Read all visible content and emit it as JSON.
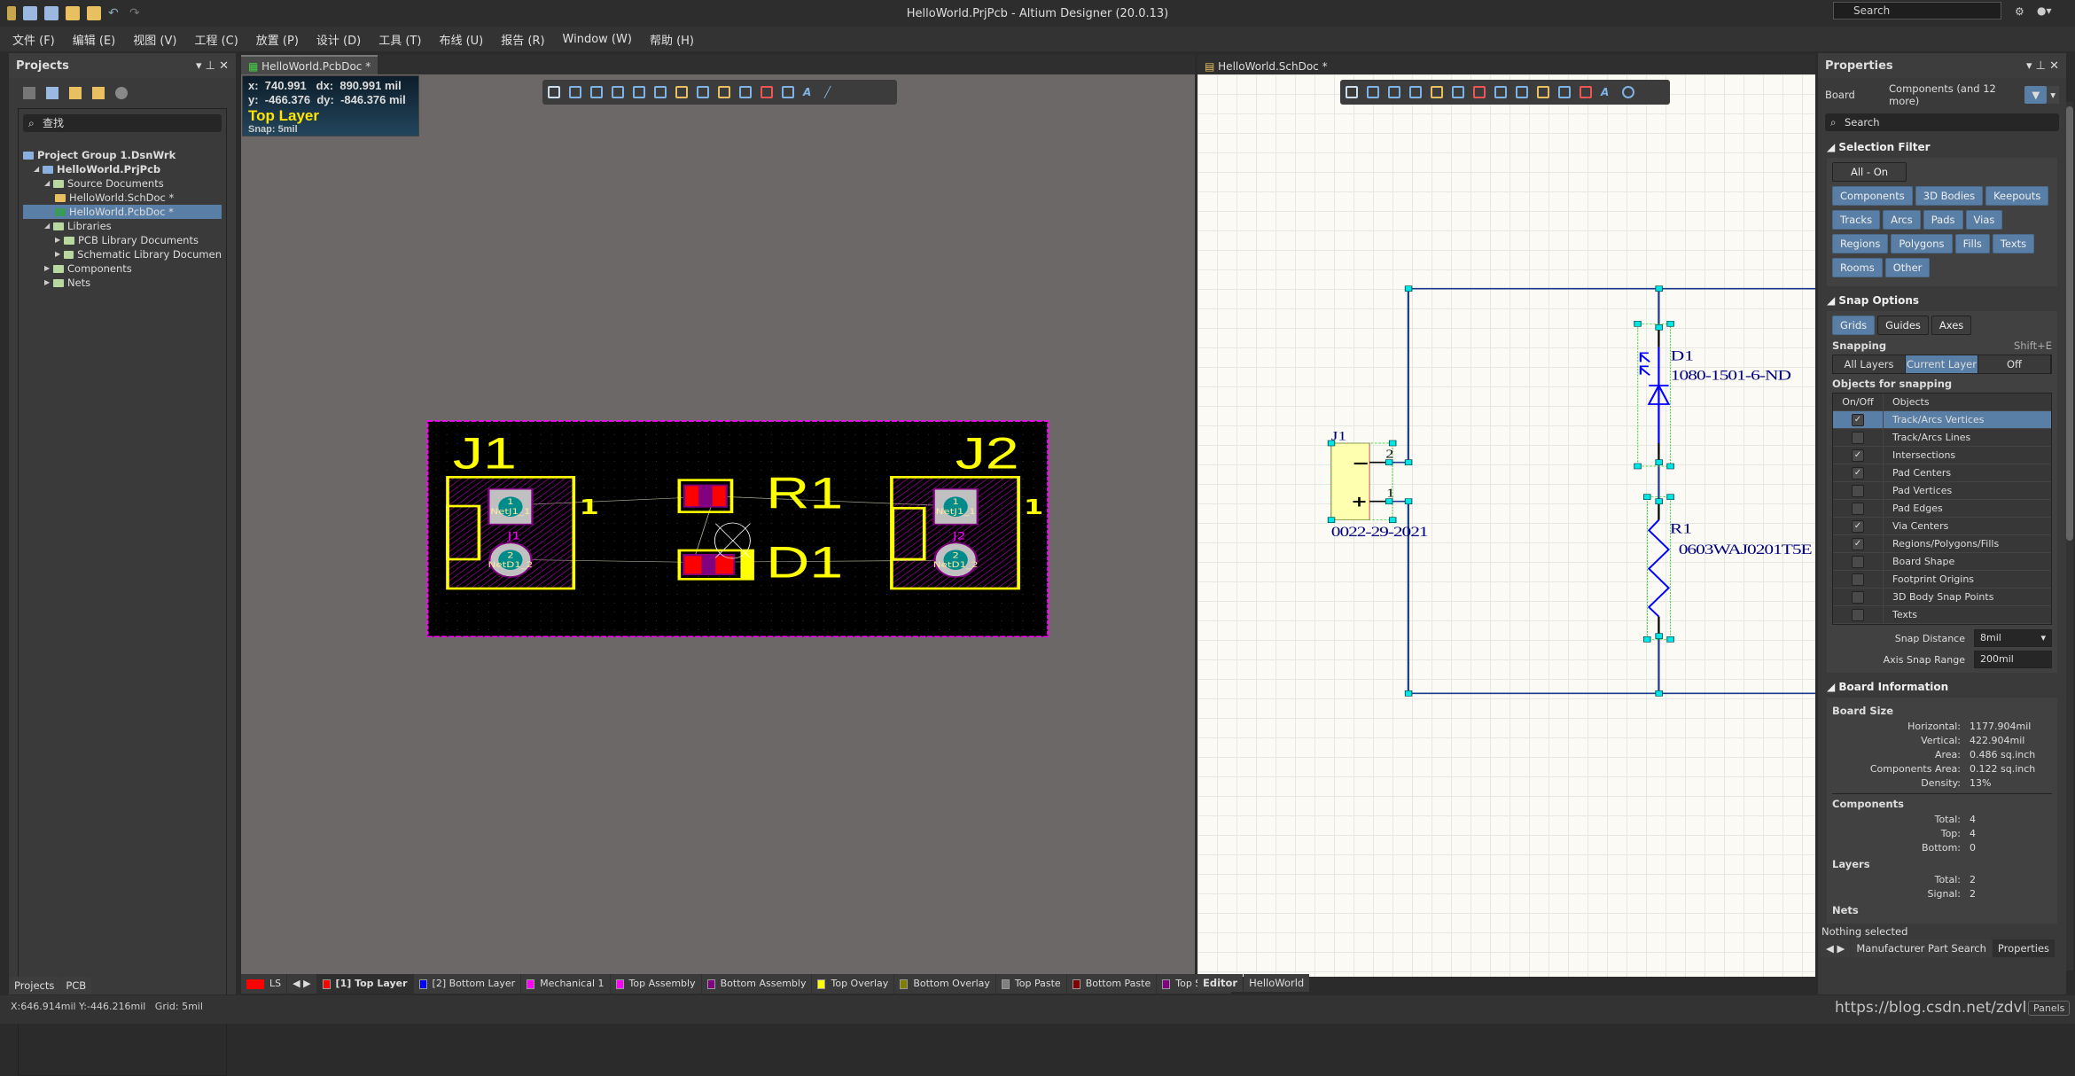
{
  "window": {
    "title": "HelloWorld.PrjPcb - Altium Designer (20.0.13)",
    "search_placeholder": "Search"
  },
  "menu": [
    "文件 (F)",
    "编辑 (E)",
    "视图 (V)",
    "工程 (C)",
    "放置 (P)",
    "设计 (D)",
    "工具 (T)",
    "布线 (U)",
    "报告 (R)",
    "Window (W)",
    "帮助 (H)"
  ],
  "projects": {
    "title": "Projects",
    "search_placeholder": "查找",
    "tree": [
      {
        "label": "Project Group 1.DsnWrk",
        "level": 0
      },
      {
        "label": "HelloWorld.PrjPcb",
        "level": 1,
        "expanded": true
      },
      {
        "label": "Source Documents",
        "level": 2,
        "expanded": true
      },
      {
        "label": "HelloWorld.SchDoc *",
        "level": 3
      },
      {
        "label": "HelloWorld.PcbDoc *",
        "level": 3,
        "selected": true
      },
      {
        "label": "Libraries",
        "level": 2,
        "expanded": true
      },
      {
        "label": "PCB Library Documents",
        "level": 3
      },
      {
        "label": "Schematic Library Documen",
        "level": 3
      },
      {
        "label": "Components",
        "level": 2
      },
      {
        "label": "Nets",
        "level": 2
      }
    ],
    "bottom_tabs": [
      "Projects",
      "PCB"
    ]
  },
  "pcb": {
    "tab": "HelloWorld.PcbDoc *",
    "coords": {
      "x": "x:  740.991",
      "dx": "dx:  890.991 mil",
      "y": "y:  -466.376",
      "dy": "dy:  -846.376 mil",
      "layer": "Top Layer",
      "snap": "Snap: 5mil"
    },
    "designators": {
      "j1": "J1",
      "j2": "J2",
      "r1": "R1",
      "d1": "D1",
      "pin1": "1",
      "pad1": "1",
      "pad2": "2",
      "net1": "NetJ1_1",
      "net2": "NetD1_2"
    },
    "layers": [
      {
        "label": "[1] Top Layer",
        "color": "#ff0000",
        "active": true
      },
      {
        "label": "[2] Bottom Layer",
        "color": "#0000ff"
      },
      {
        "label": "Mechanical 1",
        "color": "#ff00ff"
      },
      {
        "label": "Top Assembly",
        "color": "#ff00ff"
      },
      {
        "label": "Bottom Assembly",
        "color": "#800080"
      },
      {
        "label": "Top Overlay",
        "color": "#ffff00"
      },
      {
        "label": "Bottom Overlay",
        "color": "#808000"
      },
      {
        "label": "Top Paste",
        "color": "#808080"
      },
      {
        "label": "Bottom Paste",
        "color": "#800000"
      },
      {
        "label": "Top Solder",
        "color": "#800080"
      }
    ],
    "ls": "LS"
  },
  "sch": {
    "tab": "HelloWorld.SchDoc *",
    "j1": "J1",
    "j1_value": "0022-29-2021",
    "d1": "D1",
    "d1_value": "1080-1501-6-ND",
    "r1": "R1",
    "r1_value": "0603WAJ0201T5E",
    "pin2": "2",
    "pin1": "1",
    "minus": "−",
    "plus": "+",
    "bottom_tabs": [
      "Editor",
      "HelloWorld"
    ]
  },
  "properties": {
    "title": "Properties",
    "board": "Board",
    "filter_summary": "Components (and 12 more)",
    "search_placeholder": "Search",
    "selection_filter": {
      "title": "Selection Filter",
      "all_on": "All - On",
      "buttons": [
        "Components",
        "3D Bodies",
        "Keepouts",
        "Tracks",
        "Arcs",
        "Pads",
        "Vias",
        "Regions",
        "Polygons",
        "Fills",
        "Texts",
        "Rooms",
        "Other"
      ]
    },
    "snap": {
      "title": "Snap Options",
      "modes": [
        "Grids",
        "Guides",
        "Axes"
      ],
      "snapping": "Snapping",
      "shortcut": "Shift+E",
      "segment": [
        "All Layers",
        "Current Layer",
        "Off"
      ],
      "segment_active": "Current Layer",
      "objects_title": "Objects for snapping",
      "col_onoff": "On/Off",
      "col_objects": "Objects",
      "objects": [
        {
          "label": "Track/Arcs Vertices",
          "on": true
        },
        {
          "label": "Track/Arcs Lines",
          "on": false
        },
        {
          "label": "Intersections",
          "on": true
        },
        {
          "label": "Pad Centers",
          "on": true
        },
        {
          "label": "Pad Vertices",
          "on": false
        },
        {
          "label": "Pad Edges",
          "on": false
        },
        {
          "label": "Via Centers",
          "on": true
        },
        {
          "label": "Regions/Polygons/Fills",
          "on": true
        },
        {
          "label": "Board Shape",
          "on": false
        },
        {
          "label": "Footprint Origins",
          "on": false
        },
        {
          "label": "3D Body Snap Points",
          "on": false
        },
        {
          "label": "Texts",
          "on": false
        }
      ],
      "distance_label": "Snap Distance",
      "distance": "8mil",
      "axis_label": "Axis Snap Range",
      "axis": "200mil"
    },
    "board_info": {
      "title": "Board Information",
      "size_title": "Board Size",
      "size": [
        {
          "k": "Horizontal:",
          "v": "1177.904mil"
        },
        {
          "k": "Vertical:",
          "v": "422.904mil"
        },
        {
          "k": "Area:",
          "v": "0.486 sq.inch"
        },
        {
          "k": "Components Area:",
          "v": "0.122 sq.inch"
        },
        {
          "k": "Density:",
          "v": "13%"
        }
      ],
      "components_title": "Components",
      "components": [
        {
          "k": "Total:",
          "v": "4"
        },
        {
          "k": "Top:",
          "v": "4"
        },
        {
          "k": "Bottom:",
          "v": "0"
        }
      ],
      "layers_title": "Layers",
      "layers": [
        {
          "k": "Total:",
          "v": "2"
        },
        {
          "k": "Signal:",
          "v": "2"
        }
      ],
      "nets_title": "Nets"
    },
    "nothing_selected": "Nothing selected",
    "bottom_tabs": [
      "Manufacturer Part Search",
      "Properties"
    ]
  },
  "status": {
    "text": "X:646.914mil Y:-446.216mil   Grid: 5mil",
    "watermark": "https://blog.csdn.net/zdvl",
    "panels": "Panels"
  }
}
